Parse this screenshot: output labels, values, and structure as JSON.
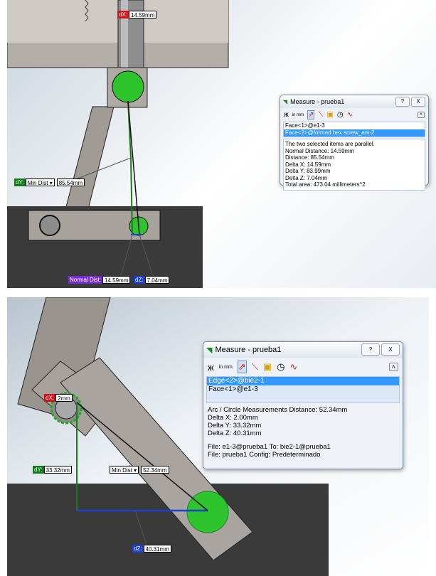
{
  "top": {
    "dialog": {
      "title": "Measure - prueba1",
      "help": "?",
      "close": "X",
      "toolbar": [
        "arc-dims-icon",
        "units-icon",
        "xyz-icon",
        "point-to-point-icon",
        "projection-icon",
        "history-icon",
        "sensor-icon"
      ],
      "units_label": "in mm",
      "selections": [
        "Face<1>@e1-3",
        "Face<2>@formed hex screw_am-2"
      ],
      "selected_index": 1,
      "results": [
        "The two selected items are parallel.",
        "Normal Distance: 14.59mm",
        "Distance: 85.54mm",
        "Delta X: 14.59mm",
        "Delta Y: 83.99mm",
        "Delta Z: 7.04mm",
        "Total area: 473.04 millimeters^2"
      ]
    },
    "tags": {
      "dx_label": "dX:",
      "dx_value": "14.59mm",
      "dy_label": "dY:",
      "dy_dropdown": "Min Dist",
      "dy_value": "85.54mm",
      "normal_label": "Normal Dist:",
      "normal_value": "14.59mm",
      "dz_label": "dZ:",
      "dz_value": "7.04mm"
    }
  },
  "bottom": {
    "dialog": {
      "title": "Measure - prueba1",
      "help": "?",
      "close": "X",
      "toolbar": [
        "arc-dims-icon",
        "units-icon",
        "xyz-icon",
        "point-to-point-icon",
        "projection-icon",
        "history-icon",
        "sensor-icon"
      ],
      "units_label": "in mm",
      "selections": [
        "Edge<2>@bie2-1",
        "Face<1>@e1-3"
      ],
      "selected_index": 0,
      "results": [
        "Arc / Circle Measurements Distance: 52.34mm",
        "Delta X: 2.00mm",
        "Delta Y: 33.32mm",
        "Delta Z: 40.31mm",
        "",
        "File: e1-3@prueba1 To: bie2-1@prueba1",
        "File: prueba1 Config: Predeterminado"
      ]
    },
    "tags": {
      "dx_label": "dX:",
      "dx_value": "2mm",
      "dy_label": "dY:",
      "dy_value": "33.32mm",
      "min_dropdown": "Min Dist",
      "min_value": "52.34mm",
      "dz_label": "dZ:",
      "dz_value": "40.31mm"
    }
  },
  "colors": {
    "red": "#d4121a",
    "green": "#117a1a",
    "blue": "#1f3fd0",
    "purple": "#7c2bd6",
    "highlight": "#3399ff",
    "part": "#a8a29c",
    "dark": "#3a3a3a"
  }
}
